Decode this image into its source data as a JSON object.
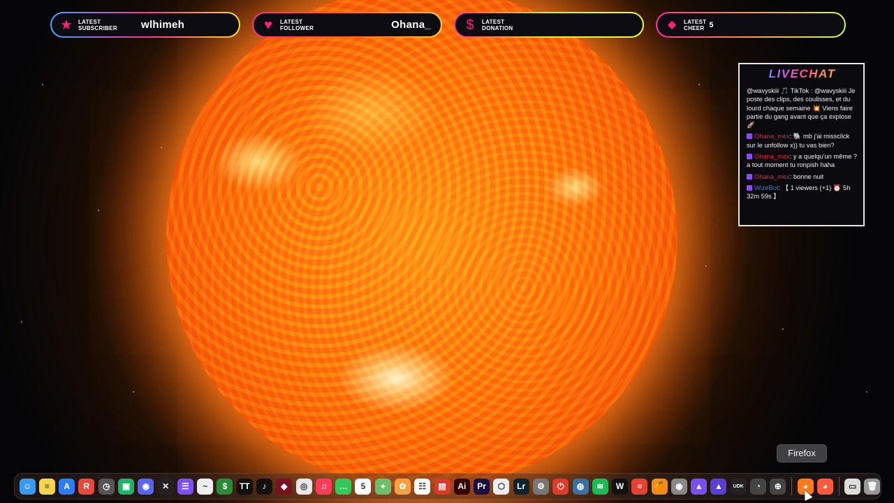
{
  "alerts": {
    "subscriber": {
      "label_line1": "LATEST",
      "label_line2": "SUBSCRIBER",
      "value": "wlhimeh",
      "icon": "star-icon"
    },
    "follower": {
      "label_line1": "LATEST",
      "label_line2": "FOLLOWER",
      "value": "Ohana_",
      "icon": "heart-icon"
    },
    "donation": {
      "label_line1": "LATEST",
      "label_line2": "DONATION",
      "value": "",
      "icon": "dollar-icon"
    },
    "cheer": {
      "label_line1": "LATEST",
      "label_line2": "CHEER",
      "value": "5",
      "icon": "diamond-icon"
    }
  },
  "livechat": {
    "title": "LIVECHAT",
    "messages": [
      {
        "user": "",
        "text": "@wavyskiii 🎵 TikTok : @wavyskiii Je poste des clips, des coulisses, et du lourd chaque semaine 💥 Viens faire partie du gang avant que ça explose 🚀"
      },
      {
        "user": "Ohana_mex",
        "text": ": 🐘 mb j'ai missclick sur le unfollow x)) tu vas bien?"
      },
      {
        "user": "Ohana_mex",
        "text": ": y a quelqu'un même ? a tout moment tu ronpish haha"
      },
      {
        "user": "Ohana_mex",
        "text": ": bonne nuit"
      },
      {
        "user": "WizeBot",
        "text": ": 【 1 viewers (+1) ⏰ 5h 32m 59s 】"
      }
    ]
  },
  "tooltip": {
    "text": "Firefox"
  },
  "dock": {
    "apps": [
      {
        "name": "finder-icon",
        "color": "#3a9af0",
        "glyph": "☺"
      },
      {
        "name": "notes-icon",
        "color": "#f5d54a",
        "glyph": "≡"
      },
      {
        "name": "app-store-icon",
        "color": "#2d7cf6",
        "glyph": "A"
      },
      {
        "name": "rewind-icon",
        "color": "#e8483a",
        "glyph": "R"
      },
      {
        "name": "activity-icon",
        "color": "#555",
        "glyph": "◷"
      },
      {
        "name": "messenger-green-icon",
        "color": "#1fb36a",
        "glyph": "▣"
      },
      {
        "name": "discord-icon",
        "color": "#5865f2",
        "glyph": "◉"
      },
      {
        "name": "capcut-icon",
        "color": "#222",
        "glyph": "✕"
      },
      {
        "name": "stack-icon",
        "color": "#7b4ff0",
        "glyph": "☰"
      },
      {
        "name": "freeform-icon",
        "color": "#eee",
        "glyph": "~"
      },
      {
        "name": "money-icon",
        "color": "#2a8a3a",
        "glyph": "$"
      },
      {
        "name": "tidal-icon",
        "color": "#111",
        "glyph": "TT"
      },
      {
        "name": "tiktok-icon",
        "color": "#111",
        "glyph": "♪"
      },
      {
        "name": "antivirus-icon",
        "color": "#7a1020",
        "glyph": "◆"
      },
      {
        "name": "chrome-icon",
        "color": "#e8e8e8",
        "glyph": "◎"
      },
      {
        "name": "music-icon",
        "color": "#fa3c5a",
        "glyph": "♫"
      },
      {
        "name": "messages-icon",
        "color": "#34c759",
        "glyph": "…"
      },
      {
        "name": "calendar-icon",
        "color": "#fff",
        "glyph": "5"
      },
      {
        "name": "maps-icon",
        "color": "#6bbf6a",
        "glyph": "⌖"
      },
      {
        "name": "photos-icon",
        "color": "#f5a142",
        "glyph": "✿"
      },
      {
        "name": "reminders-icon",
        "color": "#fff",
        "glyph": "☷"
      },
      {
        "name": "pdf-icon",
        "color": "#d93b2b",
        "glyph": "▤"
      },
      {
        "name": "illustrator-icon",
        "color": "#330000",
        "glyph": "Ai"
      },
      {
        "name": "premiere-icon",
        "color": "#1a0f40",
        "glyph": "Pr"
      },
      {
        "name": "unity-icon",
        "color": "#eee",
        "glyph": "⬡"
      },
      {
        "name": "lightroom-icon",
        "color": "#0f2230",
        "glyph": "Lr"
      },
      {
        "name": "settings-icon",
        "color": "#777",
        "glyph": "⚙"
      },
      {
        "name": "power-icon",
        "color": "#e03a2a",
        "glyph": "⏻"
      },
      {
        "name": "quicktime-icon",
        "color": "#3a6fa0",
        "glyph": "◍"
      },
      {
        "name": "spotify-icon",
        "color": "#1db954",
        "glyph": "≋"
      },
      {
        "name": "waves-icon",
        "color": "#111",
        "glyph": "W"
      },
      {
        "name": "todoist-icon",
        "color": "#e44332",
        "glyph": "≡"
      },
      {
        "name": "fl-studio-icon",
        "color": "#f08c1c",
        "glyph": "🍊"
      },
      {
        "name": "camera-icon",
        "color": "#888",
        "glyph": "◉"
      },
      {
        "name": "affinity-icon",
        "color": "#7a4ff0",
        "glyph": "▲"
      },
      {
        "name": "affinity2-icon",
        "color": "#5a3fd0",
        "glyph": "▲"
      },
      {
        "name": "udk-icon",
        "color": "#222",
        "glyph": "UDK"
      },
      {
        "name": "gauge-icon",
        "color": "#444",
        "glyph": "◔"
      },
      {
        "name": "audio-icon",
        "color": "#444",
        "glyph": "⊕"
      }
    ],
    "recent": [
      {
        "name": "firefox-icon",
        "color": "#ff7a1c",
        "glyph": "◕"
      },
      {
        "name": "firefox-dev-icon",
        "color": "#ff5a3c",
        "glyph": "◕"
      }
    ],
    "trailing": [
      {
        "name": "downloads-folder-icon",
        "color": "#ddd",
        "glyph": "▭"
      },
      {
        "name": "trash-icon",
        "color": "#999",
        "glyph": "🗑"
      }
    ]
  }
}
